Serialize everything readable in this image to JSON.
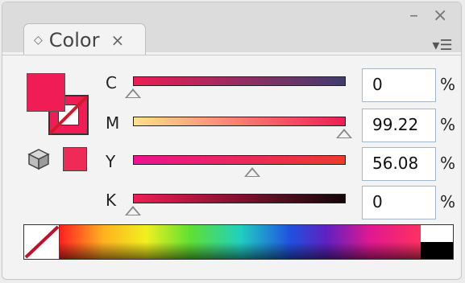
{
  "panel": {
    "tab_label": "Color",
    "tab_close_glyph": "×",
    "collapse_glyph": "◇",
    "minimize_glyph": "–",
    "close_glyph": "×",
    "menu_icon": "panel-menu-icon"
  },
  "swatches": {
    "fill_color": "#ef1c55",
    "stroke_color": "#ef1c55",
    "out_of_web_gamut_swatch": "#ef2a56"
  },
  "sliders": [
    {
      "label": "C",
      "value": "0",
      "unit": "%",
      "level": 0.0,
      "gradient": [
        "#ef1c55",
        "#3f3c6e"
      ]
    },
    {
      "label": "M",
      "value": "99.22",
      "unit": "%",
      "level": 0.9922,
      "gradient": [
        "#ffe08a",
        "#ef1c55"
      ]
    },
    {
      "label": "Y",
      "value": "56.08",
      "unit": "%",
      "level": 0.5608,
      "gradient": [
        "#ef1090",
        "#ef3a2a"
      ]
    },
    {
      "label": "K",
      "value": "0",
      "unit": "%",
      "level": 0.0,
      "gradient": [
        "#ef1c55",
        "#120508"
      ]
    }
  ],
  "spectrum": {
    "none_swatch": "none-color-icon",
    "white": "#ffffff",
    "black": "#000000"
  }
}
